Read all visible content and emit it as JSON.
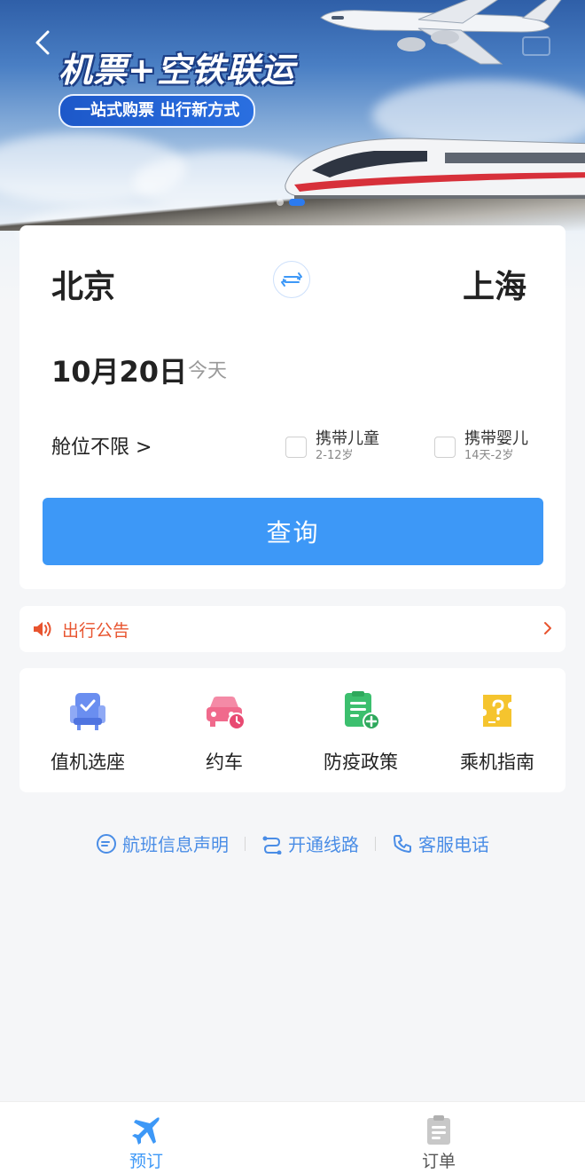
{
  "banner": {
    "title": "机票+空铁联运",
    "subtitle": "一站式购票 出行新方式"
  },
  "search": {
    "from_city": "北京",
    "to_city": "上海",
    "date": "10月20日",
    "date_note": "今天",
    "cabin": "舱位不限 >",
    "child_label": "携带儿童",
    "child_age": "2-12岁",
    "infant_label": "携带婴儿",
    "infant_age": "14天-2岁",
    "search_button": "查询"
  },
  "notice": {
    "text": "出行公告"
  },
  "services": [
    {
      "label": "值机选座",
      "icon": "seat-checkin-icon"
    },
    {
      "label": "约车",
      "icon": "car-booking-icon"
    },
    {
      "label": "防疫政策",
      "icon": "policy-document-icon"
    },
    {
      "label": "乘机指南",
      "icon": "guide-icon"
    }
  ],
  "links": [
    {
      "label": "航班信息声明",
      "icon": "statement-icon"
    },
    {
      "label": "开通线路",
      "icon": "route-icon"
    },
    {
      "label": "客服电话",
      "icon": "phone-icon"
    }
  ],
  "tabs": [
    {
      "label": "预订",
      "icon": "plane-icon",
      "active": true
    },
    {
      "label": "订单",
      "icon": "clipboard-icon",
      "active": false
    }
  ],
  "colors": {
    "primary": "#3d98f7",
    "notice": "#e8542f",
    "link": "#4a8de6",
    "seat_icon": "#6a8ef0",
    "car_icon": "#f06a8c",
    "policy_icon": "#3cbf6e",
    "guide_icon": "#f5c42e"
  }
}
